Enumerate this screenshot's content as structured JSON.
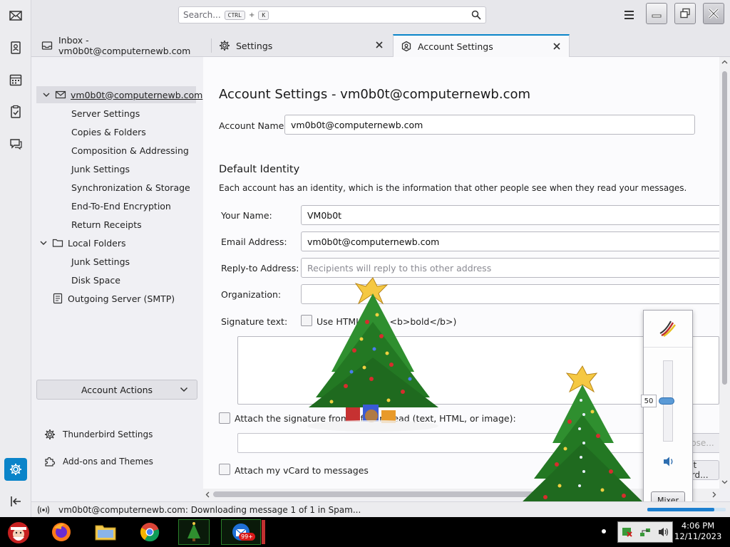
{
  "spaces": {
    "mail": "mail-icon",
    "address_book": "address-book-icon",
    "calendar": "calendar-icon",
    "tasks": "tasks-icon",
    "chat": "chat-icon",
    "settings": "gear-icon",
    "collapse": "collapse-icon"
  },
  "titlebar": {
    "search_placeholder": "Search...",
    "shortcut_key1": "CTRL",
    "shortcut_plus": "+",
    "shortcut_key2": "K"
  },
  "tabs": [
    {
      "label": "Inbox - vm0b0t@computernewb.com",
      "icon": "inbox-icon"
    },
    {
      "label": "Settings",
      "icon": "gear-icon"
    },
    {
      "label": "Account Settings",
      "icon": "account-settings-icon"
    }
  ],
  "tree": {
    "account": "vm0b0t@computernewb.com",
    "account_children": [
      "Server Settings",
      "Copies & Folders",
      "Composition & Addressing",
      "Junk Settings",
      "Synchronization & Storage",
      "End-To-End Encryption",
      "Return Receipts"
    ],
    "local_folders": "Local Folders",
    "local_children": [
      "Junk Settings",
      "Disk Space"
    ],
    "smtp": "Outgoing Server (SMTP)",
    "account_actions": "Account Actions",
    "thunderbird_settings": "Thunderbird Settings",
    "addons": "Add-ons and Themes"
  },
  "content": {
    "title": "Account Settings - vm0b0t@computernewb.com",
    "account_name_label": "Account Name:",
    "account_name_value": "vm0b0t@computernewb.com",
    "default_identity_heading": "Default Identity",
    "identity_description": "Each account has an identity, which is the information that other people see when they read your messages.",
    "your_name_label": "Your Name:",
    "your_name_value": "VM0b0t",
    "email_label": "Email Address:",
    "email_value": "vm0b0t@computernewb.com",
    "reply_to_label": "Reply-to Address:",
    "reply_to_placeholder": "Recipients will reply to this other address",
    "organization_label": "Organization:",
    "signature_label": "Signature text:",
    "use_html_label": "Use HTML (e.g., <b>bold</b>)",
    "attach_signature_label": "Attach the signature from a file instead (text, HTML, or image):",
    "choose_label": "Choose...",
    "attach_vcard_label": "Attach my vCard to messages",
    "edit_vcard_label": "Edit Card..."
  },
  "status": {
    "text": "vm0b0t@computernewb.com: Downloading message 1 of 1 in Spam...",
    "progress": 0.85
  },
  "volume": {
    "level": 50,
    "level_text": "50",
    "mixer_label": "Mixer"
  },
  "taskbar": {
    "time": "4:06 PM",
    "date": "12/11/2023",
    "badge": "99+"
  },
  "colors": {
    "accent": "#0a84c9",
    "tree_selected": "#dcdce2"
  }
}
